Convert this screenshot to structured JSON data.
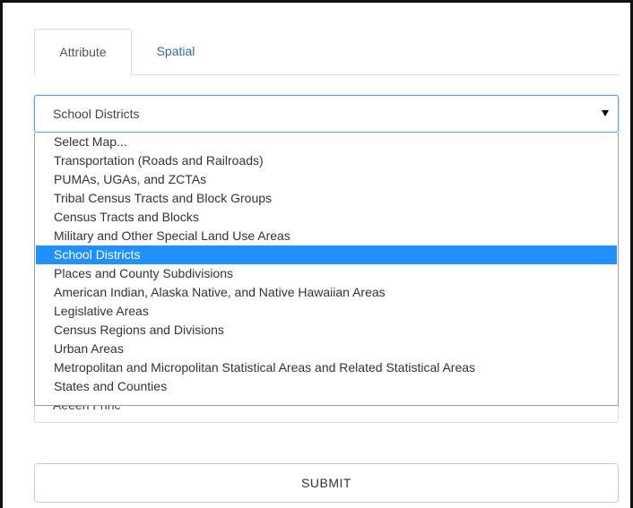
{
  "tabs": [
    {
      "label": "Attribute",
      "active": true
    },
    {
      "label": "Spatial",
      "active": false
    }
  ],
  "map_select": {
    "selected": "School Districts",
    "options": [
      "Select Map...",
      "Transportation (Roads and Railroads)",
      "PUMAs, UGAs, and ZCTAs",
      "Tribal Census Tracts and Block Groups",
      "Census Tracts and Blocks",
      "Military and Other Special Land Use Areas",
      "School Districts",
      "Places and County Subdivisions",
      "American Indian, Alaska Native, and Native Hawaiian Areas",
      "Legislative Areas",
      "Census Regions and Divisions",
      "Urban Areas",
      "Metropolitan and Micropolitan Statistical Areas and Related Statistical Areas",
      "States and Counties"
    ],
    "highlighted_index": 6
  },
  "hidden_field": {
    "value": "Aeeen Frinc"
  },
  "submit": {
    "label": "SUBMIT"
  },
  "colors": {
    "tab_link": "#2a6fa8",
    "highlight": "#1e90ff",
    "select_focus": "#5aa0e6"
  },
  "icons": {
    "select_arrow": "caret-down-icon"
  }
}
